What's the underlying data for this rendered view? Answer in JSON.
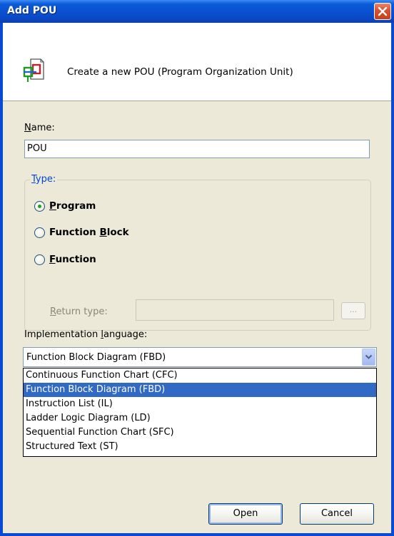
{
  "window": {
    "title": "Add POU"
  },
  "header": {
    "description": "Create a new POU (Program Organization Unit)"
  },
  "name_field": {
    "label_first": "N",
    "label_rest": "ame:",
    "value": "POU"
  },
  "type_group": {
    "legend_first": "T",
    "legend_rest": "ype:",
    "options": [
      {
        "pre": "",
        "ul": "P",
        "post": "rogram",
        "checked": true
      },
      {
        "pre": "Function ",
        "ul": "B",
        "post": "lock",
        "checked": false
      },
      {
        "pre": "",
        "ul": "F",
        "post": "unction",
        "checked": false
      }
    ],
    "return_type_label_first": "R",
    "return_type_label_rest": "eturn type:",
    "return_type_value": "",
    "browse_button_label": "..."
  },
  "implementation": {
    "label_pre": "Implementation ",
    "label_ul": "l",
    "label_post": "anguage:",
    "selected": "Function Block Diagram (FBD)",
    "options": [
      "Continuous Function Chart (CFC)",
      "Function Block Diagram (FBD)",
      "Instruction List (IL)",
      "Ladder Logic Diagram (LD)",
      "Sequential Function Chart (SFC)",
      "Structured Text (ST)"
    ],
    "highlighted_index": 1
  },
  "buttons": {
    "open": "Open",
    "cancel": "Cancel"
  },
  "colors": {
    "titlebar": "#0a4fd0",
    "close_button": "#d8502f",
    "dialog_background": "#ece9d8",
    "selection": "#316ac5",
    "group_legend": "#0046d5",
    "radio_dot": "#21a121"
  },
  "icons": {
    "header_icon": "pou-document-icon",
    "close": "close-icon",
    "combo_arrow": "chevron-down-icon"
  }
}
